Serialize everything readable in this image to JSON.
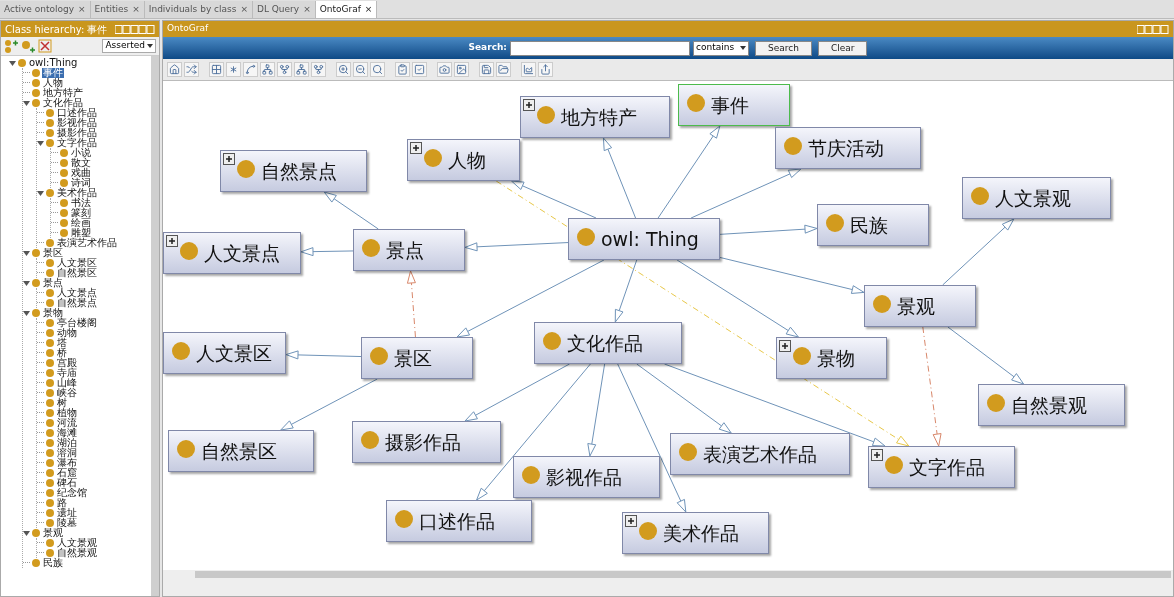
{
  "tabs": [
    {
      "label": "Active ontology",
      "close": "×",
      "selected": false
    },
    {
      "label": "Entities",
      "close": "×",
      "selected": false
    },
    {
      "label": "Individuals by class",
      "close": "×",
      "selected": false
    },
    {
      "label": "DL Query",
      "close": "×",
      "selected": false
    },
    {
      "label": "OntoGraf",
      "close": "×",
      "selected": true
    }
  ],
  "class_panel": {
    "title": "Class hierarchy: 事件",
    "mode": "Asserted",
    "tree": [
      {
        "label": "owl:Thing",
        "selected": false,
        "expanded": true,
        "children": [
          {
            "label": "事件",
            "selected": true
          },
          {
            "label": "人物",
            "selected": false
          },
          {
            "label": "地方特产",
            "selected": false
          },
          {
            "label": "文化作品",
            "selected": false,
            "expanded": true,
            "children": [
              {
                "label": "口述作品",
                "selected": false
              },
              {
                "label": "影视作品",
                "selected": false
              },
              {
                "label": "摄影作品",
                "selected": false
              },
              {
                "label": "文字作品",
                "selected": false,
                "expanded": true,
                "children": [
                  {
                    "label": "小说",
                    "selected": false
                  },
                  {
                    "label": "散文",
                    "selected": false
                  },
                  {
                    "label": "戏曲",
                    "selected": false
                  },
                  {
                    "label": "诗词",
                    "selected": false
                  }
                ]
              },
              {
                "label": "美术作品",
                "selected": false,
                "expanded": true,
                "children": [
                  {
                    "label": "书法",
                    "selected": false
                  },
                  {
                    "label": "篆刻",
                    "selected": false
                  },
                  {
                    "label": "绘画",
                    "selected": false
                  },
                  {
                    "label": "雕塑",
                    "selected": false
                  }
                ]
              },
              {
                "label": "表演艺术作品",
                "selected": false
              }
            ]
          },
          {
            "label": "景区",
            "selected": false,
            "expanded": true,
            "children": [
              {
                "label": "人文景区",
                "selected": false
              },
              {
                "label": "自然景区",
                "selected": false
              }
            ]
          },
          {
            "label": "景点",
            "selected": false,
            "expanded": true,
            "children": [
              {
                "label": "人文景点",
                "selected": false
              },
              {
                "label": "自然景点",
                "selected": false
              }
            ]
          },
          {
            "label": "景物",
            "selected": false,
            "expanded": true,
            "children": [
              {
                "label": "亭台楼阁",
                "selected": false
              },
              {
                "label": "动物",
                "selected": false
              },
              {
                "label": "塔",
                "selected": false
              },
              {
                "label": "桥",
                "selected": false
              },
              {
                "label": "宫殿",
                "selected": false
              },
              {
                "label": "寺庙",
                "selected": false
              },
              {
                "label": "山峰",
                "selected": false
              },
              {
                "label": "峡谷",
                "selected": false
              },
              {
                "label": "树",
                "selected": false
              },
              {
                "label": "植物",
                "selected": false
              },
              {
                "label": "河流",
                "selected": false
              },
              {
                "label": "海滩",
                "selected": false
              },
              {
                "label": "湖泊",
                "selected": false
              },
              {
                "label": "溶洞",
                "selected": false
              },
              {
                "label": "瀑布",
                "selected": false
              },
              {
                "label": "石窟",
                "selected": false
              },
              {
                "label": "碑石",
                "selected": false
              },
              {
                "label": "纪念馆",
                "selected": false
              },
              {
                "label": "路",
                "selected": false
              },
              {
                "label": "遗址",
                "selected": false
              },
              {
                "label": "陵墓",
                "selected": false
              }
            ]
          },
          {
            "label": "景观",
            "selected": false,
            "expanded": true,
            "children": [
              {
                "label": "人文景观",
                "selected": false
              },
              {
                "label": "自然景观",
                "selected": false
              }
            ]
          },
          {
            "label": "民族",
            "selected": false
          }
        ]
      }
    ]
  },
  "ontograf": {
    "title": "OntoGraf",
    "search_label": "Search:",
    "match": "contains",
    "buttons": [
      "Search",
      "Clear"
    ],
    "nodes": [
      {
        "label": "地方特产",
        "expandable": true,
        "selected": false
      },
      {
        "label": "事件",
        "expandable": false,
        "selected": true
      },
      {
        "label": "人物",
        "expandable": true,
        "selected": false
      },
      {
        "label": "节庆活动",
        "expandable": false,
        "selected": false
      },
      {
        "label": "自然景点",
        "expandable": true,
        "selected": false
      },
      {
        "label": "人文景观",
        "expandable": false,
        "selected": false
      },
      {
        "label": "民族",
        "expandable": false,
        "selected": false
      },
      {
        "label": "人文景点",
        "expandable": true,
        "selected": false
      },
      {
        "label": "景点",
        "expandable": false,
        "selected": false
      },
      {
        "label": "owl: Thing",
        "expandable": false,
        "selected": false
      },
      {
        "label": "景观",
        "expandable": false,
        "selected": false
      },
      {
        "label": "人文景区",
        "expandable": false,
        "selected": false
      },
      {
        "label": "景区",
        "expandable": false,
        "selected": false
      },
      {
        "label": "文化作品",
        "expandable": false,
        "selected": false
      },
      {
        "label": "景物",
        "expandable": true,
        "selected": false
      },
      {
        "label": "自然景观",
        "expandable": false,
        "selected": false
      },
      {
        "label": "自然景区",
        "expandable": false,
        "selected": false
      },
      {
        "label": "摄影作品",
        "expandable": false,
        "selected": false
      },
      {
        "label": "表演艺术作品",
        "expandable": false,
        "selected": false
      },
      {
        "label": "文字作品",
        "expandable": true,
        "selected": false
      },
      {
        "label": "影视作品",
        "expandable": false,
        "selected": false
      },
      {
        "label": "口述作品",
        "expandable": false,
        "selected": false
      },
      {
        "label": "美术作品",
        "expandable": true,
        "selected": false
      }
    ]
  }
}
